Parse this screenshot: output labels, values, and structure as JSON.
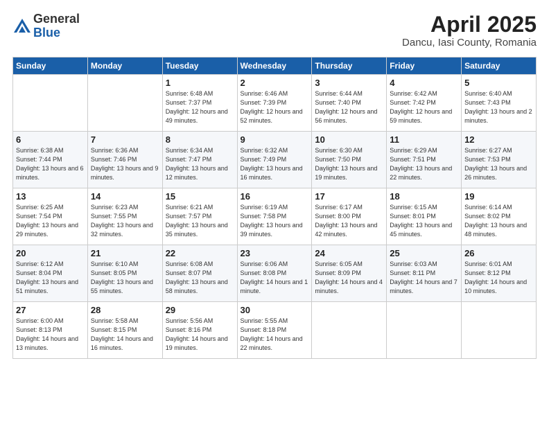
{
  "logo": {
    "general": "General",
    "blue": "Blue"
  },
  "header": {
    "title": "April 2025",
    "subtitle": "Dancu, Iasi County, Romania"
  },
  "weekdays": [
    "Sunday",
    "Monday",
    "Tuesday",
    "Wednesday",
    "Thursday",
    "Friday",
    "Saturday"
  ],
  "weeks": [
    [
      {
        "day": "",
        "info": ""
      },
      {
        "day": "",
        "info": ""
      },
      {
        "day": "1",
        "info": "Sunrise: 6:48 AM\nSunset: 7:37 PM\nDaylight: 12 hours\nand 49 minutes."
      },
      {
        "day": "2",
        "info": "Sunrise: 6:46 AM\nSunset: 7:39 PM\nDaylight: 12 hours\nand 52 minutes."
      },
      {
        "day": "3",
        "info": "Sunrise: 6:44 AM\nSunset: 7:40 PM\nDaylight: 12 hours\nand 56 minutes."
      },
      {
        "day": "4",
        "info": "Sunrise: 6:42 AM\nSunset: 7:42 PM\nDaylight: 12 hours\nand 59 minutes."
      },
      {
        "day": "5",
        "info": "Sunrise: 6:40 AM\nSunset: 7:43 PM\nDaylight: 13 hours\nand 2 minutes."
      }
    ],
    [
      {
        "day": "6",
        "info": "Sunrise: 6:38 AM\nSunset: 7:44 PM\nDaylight: 13 hours\nand 6 minutes."
      },
      {
        "day": "7",
        "info": "Sunrise: 6:36 AM\nSunset: 7:46 PM\nDaylight: 13 hours\nand 9 minutes."
      },
      {
        "day": "8",
        "info": "Sunrise: 6:34 AM\nSunset: 7:47 PM\nDaylight: 13 hours\nand 12 minutes."
      },
      {
        "day": "9",
        "info": "Sunrise: 6:32 AM\nSunset: 7:49 PM\nDaylight: 13 hours\nand 16 minutes."
      },
      {
        "day": "10",
        "info": "Sunrise: 6:30 AM\nSunset: 7:50 PM\nDaylight: 13 hours\nand 19 minutes."
      },
      {
        "day": "11",
        "info": "Sunrise: 6:29 AM\nSunset: 7:51 PM\nDaylight: 13 hours\nand 22 minutes."
      },
      {
        "day": "12",
        "info": "Sunrise: 6:27 AM\nSunset: 7:53 PM\nDaylight: 13 hours\nand 26 minutes."
      }
    ],
    [
      {
        "day": "13",
        "info": "Sunrise: 6:25 AM\nSunset: 7:54 PM\nDaylight: 13 hours\nand 29 minutes."
      },
      {
        "day": "14",
        "info": "Sunrise: 6:23 AM\nSunset: 7:55 PM\nDaylight: 13 hours\nand 32 minutes."
      },
      {
        "day": "15",
        "info": "Sunrise: 6:21 AM\nSunset: 7:57 PM\nDaylight: 13 hours\nand 35 minutes."
      },
      {
        "day": "16",
        "info": "Sunrise: 6:19 AM\nSunset: 7:58 PM\nDaylight: 13 hours\nand 39 minutes."
      },
      {
        "day": "17",
        "info": "Sunrise: 6:17 AM\nSunset: 8:00 PM\nDaylight: 13 hours\nand 42 minutes."
      },
      {
        "day": "18",
        "info": "Sunrise: 6:15 AM\nSunset: 8:01 PM\nDaylight: 13 hours\nand 45 minutes."
      },
      {
        "day": "19",
        "info": "Sunrise: 6:14 AM\nSunset: 8:02 PM\nDaylight: 13 hours\nand 48 minutes."
      }
    ],
    [
      {
        "day": "20",
        "info": "Sunrise: 6:12 AM\nSunset: 8:04 PM\nDaylight: 13 hours\nand 51 minutes."
      },
      {
        "day": "21",
        "info": "Sunrise: 6:10 AM\nSunset: 8:05 PM\nDaylight: 13 hours\nand 55 minutes."
      },
      {
        "day": "22",
        "info": "Sunrise: 6:08 AM\nSunset: 8:07 PM\nDaylight: 13 hours\nand 58 minutes."
      },
      {
        "day": "23",
        "info": "Sunrise: 6:06 AM\nSunset: 8:08 PM\nDaylight: 14 hours\nand 1 minute."
      },
      {
        "day": "24",
        "info": "Sunrise: 6:05 AM\nSunset: 8:09 PM\nDaylight: 14 hours\nand 4 minutes."
      },
      {
        "day": "25",
        "info": "Sunrise: 6:03 AM\nSunset: 8:11 PM\nDaylight: 14 hours\nand 7 minutes."
      },
      {
        "day": "26",
        "info": "Sunrise: 6:01 AM\nSunset: 8:12 PM\nDaylight: 14 hours\nand 10 minutes."
      }
    ],
    [
      {
        "day": "27",
        "info": "Sunrise: 6:00 AM\nSunset: 8:13 PM\nDaylight: 14 hours\nand 13 minutes."
      },
      {
        "day": "28",
        "info": "Sunrise: 5:58 AM\nSunset: 8:15 PM\nDaylight: 14 hours\nand 16 minutes."
      },
      {
        "day": "29",
        "info": "Sunrise: 5:56 AM\nSunset: 8:16 PM\nDaylight: 14 hours\nand 19 minutes."
      },
      {
        "day": "30",
        "info": "Sunrise: 5:55 AM\nSunset: 8:18 PM\nDaylight: 14 hours\nand 22 minutes."
      },
      {
        "day": "",
        "info": ""
      },
      {
        "day": "",
        "info": ""
      },
      {
        "day": "",
        "info": ""
      }
    ]
  ]
}
